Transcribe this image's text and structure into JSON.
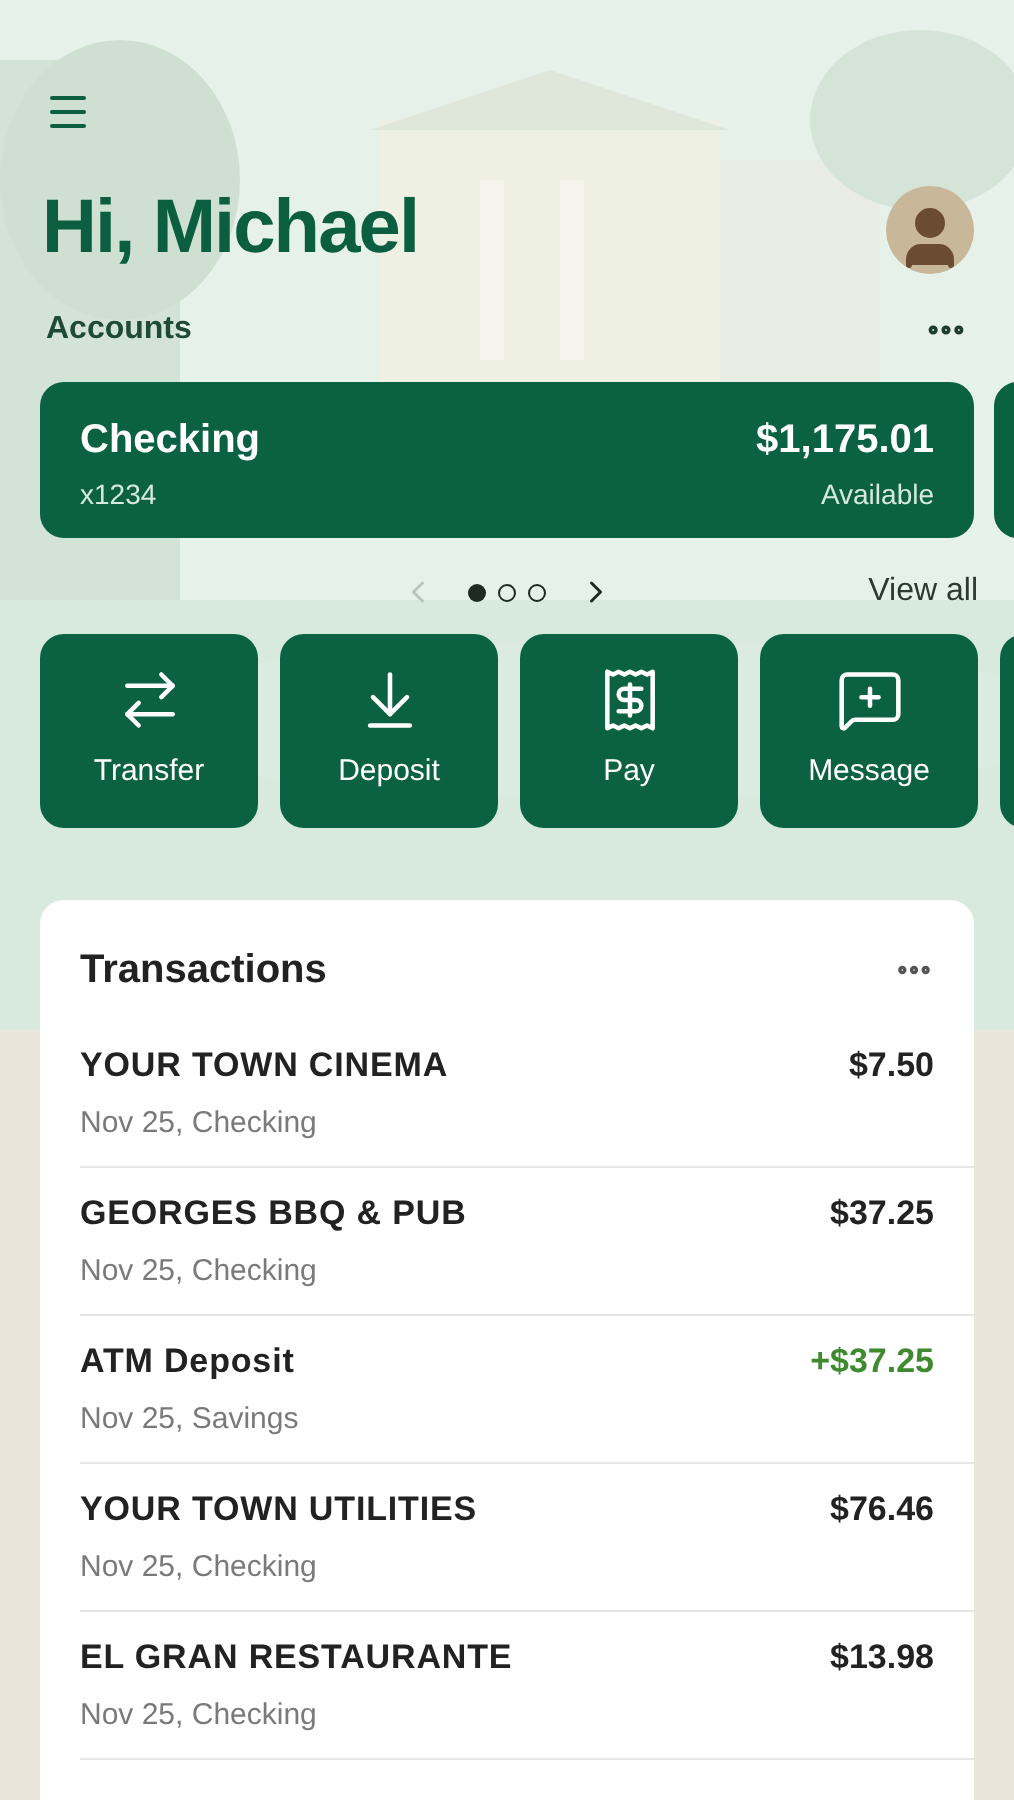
{
  "greeting": "Hi, Michael",
  "accounts": {
    "title": "Accounts",
    "cards": [
      {
        "name": "Checking",
        "number": "x1234",
        "balance": "$1,175.01",
        "balance_label": "Available"
      }
    ],
    "pages": [
      {
        "selected": true
      },
      {
        "selected": false
      },
      {
        "selected": false
      }
    ],
    "view_all": "View all"
  },
  "actions": [
    {
      "kind": "transfer",
      "label": "Transfer"
    },
    {
      "kind": "deposit",
      "label": "Deposit"
    },
    {
      "kind": "pay",
      "label": "Pay"
    },
    {
      "kind": "message",
      "label": "Message"
    }
  ],
  "transactions": {
    "title": "Transactions",
    "rows": [
      {
        "name": "YOUR TOWN CINEMA",
        "detail": "Nov 25, Checking",
        "amount": "$7.50",
        "kind": "debit"
      },
      {
        "name": "GEORGES BBQ & PUB",
        "detail": "Nov 25, Checking",
        "amount": "$37.25",
        "kind": "debit"
      },
      {
        "name": "ATM Deposit",
        "detail": "Nov 25, Savings",
        "amount": "+$37.25",
        "kind": "credit"
      },
      {
        "name": "YOUR TOWN UTILITIES",
        "detail": "Nov 25, Checking",
        "amount": "$76.46",
        "kind": "debit"
      },
      {
        "name": "EL GRAN RESTAURANTE",
        "detail": "Nov 25, Checking",
        "amount": "$13.98",
        "kind": "debit"
      }
    ]
  }
}
